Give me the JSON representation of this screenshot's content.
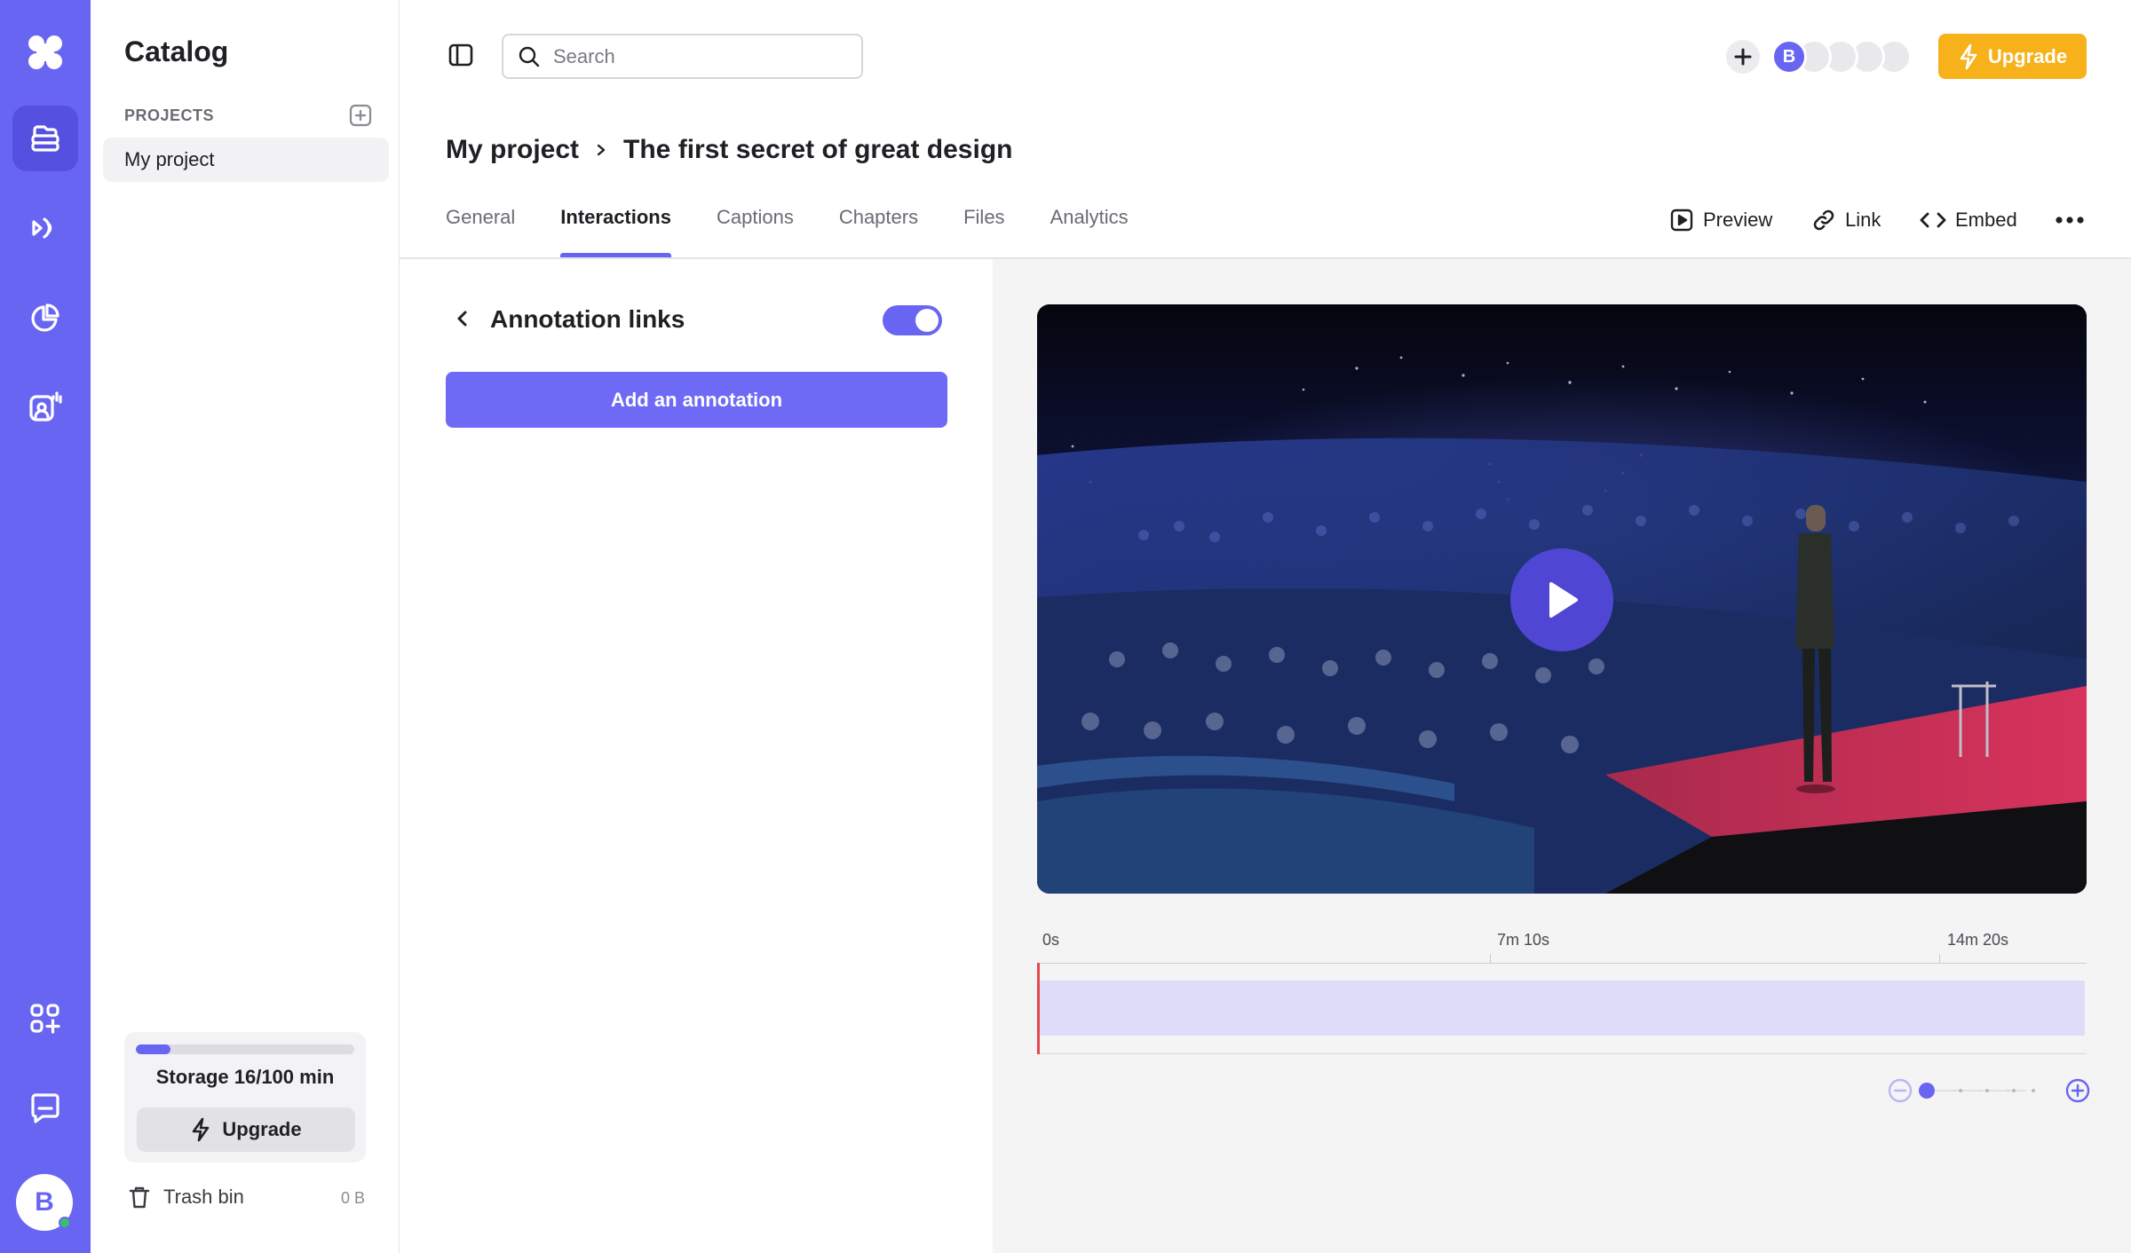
{
  "rail": {
    "items": [
      "logo",
      "catalog",
      "live",
      "analytics",
      "interactive",
      "integrations",
      "support"
    ],
    "avatar_initial": "B"
  },
  "catalog": {
    "title": "Catalog",
    "projects_label": "PROJECTS",
    "project_item": "My project",
    "storage_text": "Storage 16/100 min",
    "storage_used_fraction": 0.16,
    "upgrade_label": "Upgrade",
    "trash_label": "Trash bin",
    "trash_size": "0 B"
  },
  "topbar": {
    "search_placeholder": "Search",
    "avatar_initial": "B",
    "upgrade_label": "Upgrade"
  },
  "breadcrumb": {
    "parent": "My project",
    "current": "The first secret of great design"
  },
  "tabs": [
    {
      "label": "General",
      "active": false
    },
    {
      "label": "Interactions",
      "active": true
    },
    {
      "label": "Captions",
      "active": false
    },
    {
      "label": "Chapters",
      "active": false
    },
    {
      "label": "Files",
      "active": false
    },
    {
      "label": "Analytics",
      "active": false
    }
  ],
  "actions": {
    "preview": "Preview",
    "link": "Link",
    "embed": "Embed"
  },
  "panel": {
    "title": "Annotation links",
    "toggle_on": true,
    "add_button": "Add an annotation"
  },
  "timeline": {
    "ticks": [
      "0s",
      "7m 10s",
      "14m 20s"
    ]
  },
  "colors": {
    "brand": "#6965f3",
    "upgrade": "#f7b11a",
    "playhead": "#e5484d"
  }
}
